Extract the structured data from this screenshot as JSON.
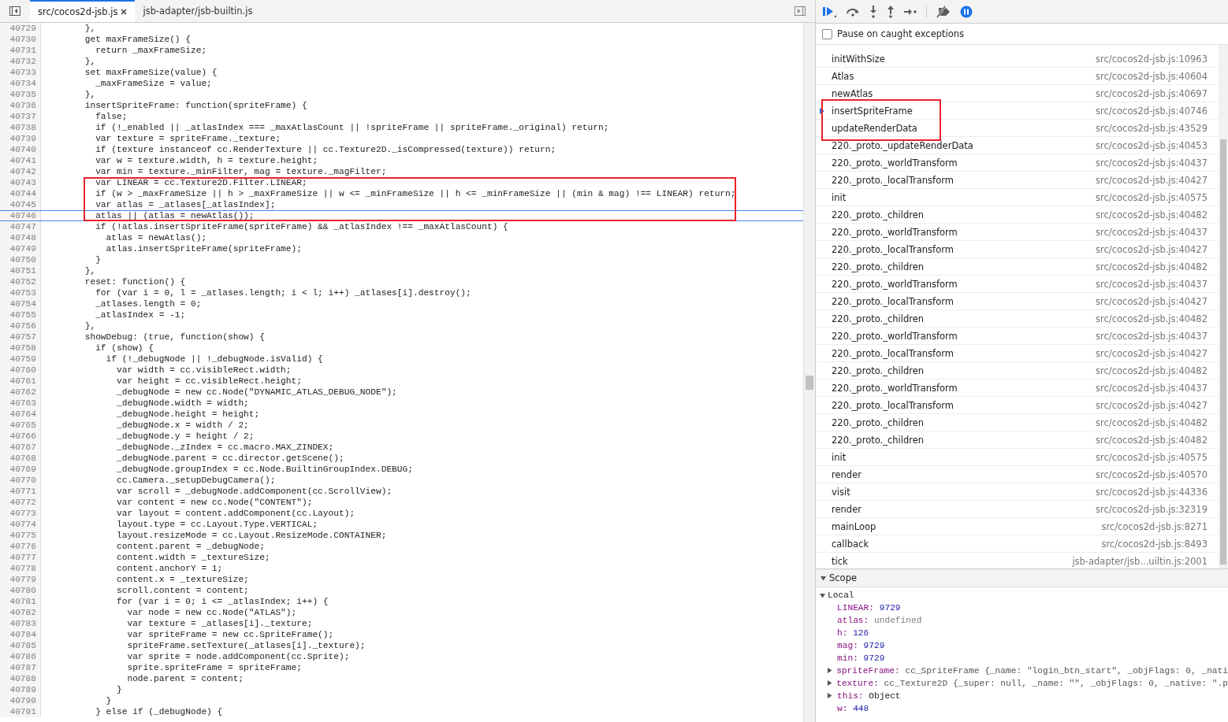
{
  "editor": {
    "tabs": [
      {
        "label": "src/cocos2d-jsb.js",
        "selected": true,
        "closable": true
      },
      {
        "label": "jsb-adapter/jsb-builtin.js",
        "selected": false,
        "closable": false
      }
    ],
    "lines": [
      {
        "number": "40729",
        "text": "        },",
        "annotated": false,
        "current": false
      },
      {
        "number": "40730",
        "text": "        get maxFrameSize() {",
        "annotated": false,
        "current": false
      },
      {
        "number": "40731",
        "text": "          return _maxFrameSize;",
        "annotated": false,
        "current": false
      },
      {
        "number": "40732",
        "text": "        },",
        "annotated": false,
        "current": false
      },
      {
        "number": "40733",
        "text": "        set maxFrameSize(value) {",
        "annotated": false,
        "current": false
      },
      {
        "number": "40734",
        "text": "          _maxFrameSize = value;",
        "annotated": false,
        "current": false
      },
      {
        "number": "40735",
        "text": "        },",
        "annotated": false,
        "current": false
      },
      {
        "number": "40736",
        "text": "        insertSpriteFrame: function(spriteFrame) {",
        "annotated": false,
        "current": false
      },
      {
        "number": "40737",
        "text": "          false;",
        "annotated": false,
        "current": false
      },
      {
        "number": "40738",
        "text": "          if (!_enabled || _atlasIndex === _maxAtlasCount || !spriteFrame || spriteFrame._original) return;",
        "annotated": false,
        "current": false
      },
      {
        "number": "40739",
        "text": "          var texture = spriteFrame._texture;",
        "annotated": false,
        "current": false
      },
      {
        "number": "40740",
        "text": "          if (texture instanceof cc.RenderTexture || cc.Texture2D._isCompressed(texture)) return;",
        "annotated": false,
        "current": false
      },
      {
        "number": "40741",
        "text": "          var w = texture.width, h = texture.height;",
        "annotated": false,
        "current": false
      },
      {
        "number": "40742",
        "text": "          var min = texture._minFilter, mag = texture._magFilter;",
        "annotated": false,
        "current": false
      },
      {
        "number": "40743",
        "text": "          var LINEAR = cc.Texture2D.Filter.LINEAR;",
        "annotated": true,
        "current": false
      },
      {
        "number": "40744",
        "text": "          if (w > _maxFrameSize || h > _maxFrameSize || w <= _minFrameSize || h <= _minFrameSize || (min & mag) !== LINEAR) return;",
        "annotated": true,
        "current": false
      },
      {
        "number": "40745",
        "text": "          var atlas = _atlases[_atlasIndex];",
        "annotated": true,
        "current": false
      },
      {
        "number": "40746",
        "text": "          atlas || (atlas = newAtlas());",
        "annotated": true,
        "current": true
      },
      {
        "number": "40747",
        "text": "          if (!atlas.insertSpriteFrame(spriteFrame) && _atlasIndex !== _maxAtlasCount) {",
        "annotated": false,
        "current": false
      },
      {
        "number": "40748",
        "text": "            atlas = newAtlas();",
        "annotated": false,
        "current": false
      },
      {
        "number": "40749",
        "text": "            atlas.insertSpriteFrame(spriteFrame);",
        "annotated": false,
        "current": false
      },
      {
        "number": "40750",
        "text": "          }",
        "annotated": false,
        "current": false
      },
      {
        "number": "40751",
        "text": "        },",
        "annotated": false,
        "current": false
      },
      {
        "number": "40752",
        "text": "        reset: function() {",
        "annotated": false,
        "current": false
      },
      {
        "number": "40753",
        "text": "          for (var i = 0, l = _atlases.length; i < l; i++) _atlases[i].destroy();",
        "annotated": false,
        "current": false
      },
      {
        "number": "40754",
        "text": "          _atlases.length = 0;",
        "annotated": false,
        "current": false
      },
      {
        "number": "40755",
        "text": "          _atlasIndex = -1;",
        "annotated": false,
        "current": false
      },
      {
        "number": "40756",
        "text": "        },",
        "annotated": false,
        "current": false
      },
      {
        "number": "40757",
        "text": "        showDebug: (true, function(show) {",
        "annotated": false,
        "current": false
      },
      {
        "number": "40758",
        "text": "          if (show) {",
        "annotated": false,
        "current": false
      },
      {
        "number": "40759",
        "text": "            if (!_debugNode || !_debugNode.isValid) {",
        "annotated": false,
        "current": false
      },
      {
        "number": "40760",
        "text": "              var width = cc.visibleRect.width;",
        "annotated": false,
        "current": false
      },
      {
        "number": "40761",
        "text": "              var height = cc.visibleRect.height;",
        "annotated": false,
        "current": false
      },
      {
        "number": "40762",
        "text": "              _debugNode = new cc.Node(\"DYNAMIC_ATLAS_DEBUG_NODE\");",
        "annotated": false,
        "current": false
      },
      {
        "number": "40763",
        "text": "              _debugNode.width = width;",
        "annotated": false,
        "current": false
      },
      {
        "number": "40764",
        "text": "              _debugNode.height = height;",
        "annotated": false,
        "current": false
      },
      {
        "number": "40765",
        "text": "              _debugNode.x = width / 2;",
        "annotated": false,
        "current": false
      },
      {
        "number": "40766",
        "text": "              _debugNode.y = height / 2;",
        "annotated": false,
        "current": false
      },
      {
        "number": "40767",
        "text": "              _debugNode._zIndex = cc.macro.MAX_ZINDEX;",
        "annotated": false,
        "current": false
      },
      {
        "number": "40768",
        "text": "              _debugNode.parent = cc.director.getScene();",
        "annotated": false,
        "current": false
      },
      {
        "number": "40769",
        "text": "              _debugNode.groupIndex = cc.Node.BuiltinGroupIndex.DEBUG;",
        "annotated": false,
        "current": false
      },
      {
        "number": "40770",
        "text": "              cc.Camera._setupDebugCamera();",
        "annotated": false,
        "current": false
      },
      {
        "number": "40771",
        "text": "              var scroll = _debugNode.addComponent(cc.ScrollView);",
        "annotated": false,
        "current": false
      },
      {
        "number": "40772",
        "text": "              var content = new cc.Node(\"CONTENT\");",
        "annotated": false,
        "current": false
      },
      {
        "number": "40773",
        "text": "              var layout = content.addComponent(cc.Layout);",
        "annotated": false,
        "current": false
      },
      {
        "number": "40774",
        "text": "              layout.type = cc.Layout.Type.VERTICAL;",
        "annotated": false,
        "current": false
      },
      {
        "number": "40775",
        "text": "              layout.resizeMode = cc.Layout.ResizeMode.CONTAINER;",
        "annotated": false,
        "current": false
      },
      {
        "number": "40776",
        "text": "              content.parent = _debugNode;",
        "annotated": false,
        "current": false
      },
      {
        "number": "40777",
        "text": "              content.width = _textureSize;",
        "annotated": false,
        "current": false
      },
      {
        "number": "40778",
        "text": "              content.anchorY = 1;",
        "annotated": false,
        "current": false
      },
      {
        "number": "40779",
        "text": "              content.x = _textureSize;",
        "annotated": false,
        "current": false
      },
      {
        "number": "40780",
        "text": "              scroll.content = content;",
        "annotated": false,
        "current": false
      },
      {
        "number": "40781",
        "text": "              for (var i = 0; i <= _atlasIndex; i++) {",
        "annotated": false,
        "current": false
      },
      {
        "number": "40782",
        "text": "                var node = new cc.Node(\"ATLAS\");",
        "annotated": false,
        "current": false
      },
      {
        "number": "40783",
        "text": "                var texture = _atlases[i]._texture;",
        "annotated": false,
        "current": false
      },
      {
        "number": "40784",
        "text": "                var spriteFrame = new cc.SpriteFrame();",
        "annotated": false,
        "current": false
      },
      {
        "number": "40785",
        "text": "                spriteFrame.setTexture(_atlases[i]._texture);",
        "annotated": false,
        "current": false
      },
      {
        "number": "40786",
        "text": "                var sprite = node.addComponent(cc.Sprite);",
        "annotated": false,
        "current": false
      },
      {
        "number": "40787",
        "text": "                sprite.spriteFrame = spriteFrame;",
        "annotated": false,
        "current": false
      },
      {
        "number": "40788",
        "text": "                node.parent = content;",
        "annotated": false,
        "current": false
      },
      {
        "number": "40789",
        "text": "              }",
        "annotated": false,
        "current": false
      },
      {
        "number": "40790",
        "text": "            }",
        "annotated": false,
        "current": false
      },
      {
        "number": "40791",
        "text": "          } else if (_debugNode) {",
        "annotated": false,
        "current": false
      }
    ]
  },
  "debugger": {
    "pause_on_caught_exceptions": {
      "label": "Pause on caught exceptions",
      "checked": false
    },
    "call_stack": [
      {
        "name": "initWithSize",
        "location": "src/cocos2d-jsb.js:10963",
        "current": false,
        "annotated": false
      },
      {
        "name": "Atlas",
        "location": "src/cocos2d-jsb.js:40604",
        "current": false,
        "annotated": false
      },
      {
        "name": "newAtlas",
        "location": "src/cocos2d-jsb.js:40697",
        "current": false,
        "annotated": false
      },
      {
        "name": "insertSpriteFrame",
        "location": "src/cocos2d-jsb.js:40746",
        "current": true,
        "annotated": true
      },
      {
        "name": "updateRenderData",
        "location": "src/cocos2d-jsb.js:43529",
        "current": false,
        "annotated": true
      },
      {
        "name": "220._proto._updateRenderData",
        "location": "src/cocos2d-jsb.js:40453",
        "current": false,
        "annotated": false
      },
      {
        "name": "220._proto._worldTransform",
        "location": "src/cocos2d-jsb.js:40437",
        "current": false,
        "annotated": false
      },
      {
        "name": "220._proto._localTransform",
        "location": "src/cocos2d-jsb.js:40427",
        "current": false,
        "annotated": false
      },
      {
        "name": "init",
        "location": "src/cocos2d-jsb.js:40575",
        "current": false,
        "annotated": false
      },
      {
        "name": "220._proto._children",
        "location": "src/cocos2d-jsb.js:40482",
        "current": false,
        "annotated": false
      },
      {
        "name": "220._proto._worldTransform",
        "location": "src/cocos2d-jsb.js:40437",
        "current": false,
        "annotated": false
      },
      {
        "name": "220._proto._localTransform",
        "location": "src/cocos2d-jsb.js:40427",
        "current": false,
        "annotated": false
      },
      {
        "name": "220._proto._children",
        "location": "src/cocos2d-jsb.js:40482",
        "current": false,
        "annotated": false
      },
      {
        "name": "220._proto._worldTransform",
        "location": "src/cocos2d-jsb.js:40437",
        "current": false,
        "annotated": false
      },
      {
        "name": "220._proto._localTransform",
        "location": "src/cocos2d-jsb.js:40427",
        "current": false,
        "annotated": false
      },
      {
        "name": "220._proto._children",
        "location": "src/cocos2d-jsb.js:40482",
        "current": false,
        "annotated": false
      },
      {
        "name": "220._proto._worldTransform",
        "location": "src/cocos2d-jsb.js:40437",
        "current": false,
        "annotated": false
      },
      {
        "name": "220._proto._localTransform",
        "location": "src/cocos2d-jsb.js:40427",
        "current": false,
        "annotated": false
      },
      {
        "name": "220._proto._children",
        "location": "src/cocos2d-jsb.js:40482",
        "current": false,
        "annotated": false
      },
      {
        "name": "220._proto._worldTransform",
        "location": "src/cocos2d-jsb.js:40437",
        "current": false,
        "annotated": false
      },
      {
        "name": "220._proto._localTransform",
        "location": "src/cocos2d-jsb.js:40427",
        "current": false,
        "annotated": false
      },
      {
        "name": "220._proto._children",
        "location": "src/cocos2d-jsb.js:40482",
        "current": false,
        "annotated": false
      },
      {
        "name": "220._proto._children",
        "location": "src/cocos2d-jsb.js:40482",
        "current": false,
        "annotated": false
      },
      {
        "name": "init",
        "location": "src/cocos2d-jsb.js:40575",
        "current": false,
        "annotated": false
      },
      {
        "name": "render",
        "location": "src/cocos2d-jsb.js:40570",
        "current": false,
        "annotated": false
      },
      {
        "name": "visit",
        "location": "src/cocos2d-jsb.js:44336",
        "current": false,
        "annotated": false
      },
      {
        "name": "render",
        "location": "src/cocos2d-jsb.js:32319",
        "current": false,
        "annotated": false
      },
      {
        "name": "mainLoop",
        "location": "src/cocos2d-jsb.js:8271",
        "current": false,
        "annotated": false
      },
      {
        "name": "callback",
        "location": "src/cocos2d-jsb.js:8493",
        "current": false,
        "annotated": false
      },
      {
        "name": "tick",
        "location": "jsb-adapter/jsb...uiltin.js:2001",
        "current": false,
        "annotated": false
      }
    ],
    "scope": {
      "title": "Scope",
      "expanded": true,
      "local": {
        "title": "Local",
        "expanded": true,
        "variables": [
          {
            "name": "LINEAR:",
            "value": "9729",
            "kind": "number",
            "expandable": false
          },
          {
            "name": "atlas:",
            "value": "undefined",
            "kind": "undefined",
            "expandable": false
          },
          {
            "name": "h:",
            "value": "126",
            "kind": "number",
            "expandable": false
          },
          {
            "name": "mag:",
            "value": "9729",
            "kind": "number",
            "expandable": false
          },
          {
            "name": "min:",
            "value": "9729",
            "kind": "number",
            "expandable": false
          },
          {
            "name": "spriteFrame:",
            "value": "cc_SpriteFrame {_name: \"login_btn_start\", _objFlags: 0, _nati",
            "kind": "object",
            "expandable": true
          },
          {
            "name": "texture:",
            "value": "cc_Texture2D {_super: null, _name: \"\", _objFlags: 0, _native: \".p",
            "kind": "object",
            "expandable": true
          },
          {
            "name": "this:",
            "value": "Object",
            "kind": "plain",
            "expandable": true
          },
          {
            "name": "w:",
            "value": "448",
            "kind": "number",
            "expandable": false
          }
        ]
      }
    }
  }
}
